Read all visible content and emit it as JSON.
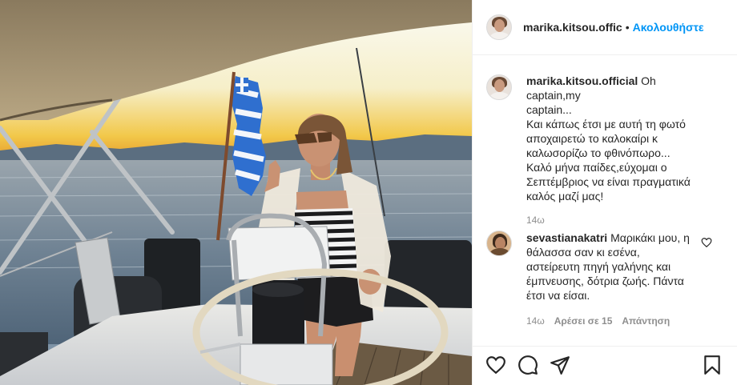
{
  "post": {
    "author": {
      "username": "marika.kitsou.offic",
      "follow_label": "Ακολουθήστε",
      "separator": "•"
    },
    "caption": {
      "username": "marika.kitsou.official",
      "lines": [
        "Oh captain,my",
        "captain...",
        "Και κάπως έτσι με αυτή τη φωτό",
        "αποχαιρετώ το καλοκαίρι κ",
        "καλωσορίζω το φθινόπωρο...",
        "Καλό μήνα παίδες,εύχομαι ο",
        "Σεπτέμβριος να είναι πραγματικά",
        "καλός μαζί μας!"
      ],
      "time": "14ω"
    },
    "comments": [
      {
        "username": "sevastianakatri",
        "lines": [
          "Μαρικάκι μου, η",
          "θάλασσα σαν κι εσένα,",
          "αστείρευτη πηγή γαλήνης και",
          "έμπνευσης, δότρια ζωής. Πάντα",
          "έτσι να είσαι."
        ],
        "time": "14ω",
        "likes": "Αρέσει σε 15",
        "reply": "Απάντηση"
      }
    ],
    "actions": {
      "like_icon": "heart-outline",
      "comment_icon": "speech-bubble",
      "share_icon": "paper-plane",
      "save_icon": "bookmark"
    },
    "colors": {
      "accent": "#0095f6",
      "text": "#262626",
      "muted": "#8e8e8e",
      "divider": "#efefef"
    }
  }
}
